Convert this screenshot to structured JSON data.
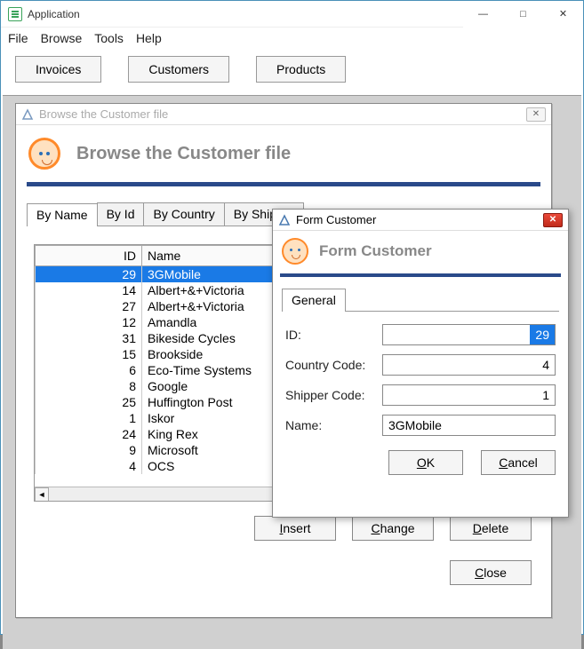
{
  "app": {
    "title": "Application"
  },
  "menu": {
    "file": "File",
    "browse": "Browse",
    "tools": "Tools",
    "help": "Help"
  },
  "toolbar": {
    "invoices": "Invoices",
    "customers": "Customers",
    "products": "Products"
  },
  "browse": {
    "title_dim": "Browse the Customer file",
    "heading": "Browse the Customer file",
    "tabs": {
      "by_name": "By Name",
      "by_id": "By Id",
      "by_country": "By Country",
      "by_shipper": "By Shipper"
    },
    "columns": {
      "id": "ID",
      "name": "Name"
    },
    "rows": [
      {
        "id": "29",
        "name": "3GMobile",
        "selected": true
      },
      {
        "id": "14",
        "name": "Albert+&+Victoria"
      },
      {
        "id": "27",
        "name": "Albert+&+Victoria"
      },
      {
        "id": "12",
        "name": "Amandla"
      },
      {
        "id": "31",
        "name": "Bikeside Cycles"
      },
      {
        "id": "15",
        "name": "Brookside"
      },
      {
        "id": "6",
        "name": "Eco-Time Systems"
      },
      {
        "id": "8",
        "name": "Google"
      },
      {
        "id": "25",
        "name": "Huffington Post"
      },
      {
        "id": "1",
        "name": "Iskor"
      },
      {
        "id": "24",
        "name": "King Rex"
      },
      {
        "id": "9",
        "name": "Microsoft"
      },
      {
        "id": "4",
        "name": "OCS"
      }
    ],
    "buttons": {
      "insert": "Insert",
      "change": "Change",
      "delete": "Delete",
      "close": "Close"
    }
  },
  "form": {
    "title": "Form Customer",
    "heading": "Form Customer",
    "tab_general": "General",
    "labels": {
      "id": "ID:",
      "country": "Country Code:",
      "shipper": "Shipper Code:",
      "name": "Name:"
    },
    "values": {
      "id": "29",
      "country": "4",
      "shipper": "1",
      "name": "3GMobile"
    },
    "buttons": {
      "ok": "OK",
      "cancel": "Cancel"
    }
  }
}
